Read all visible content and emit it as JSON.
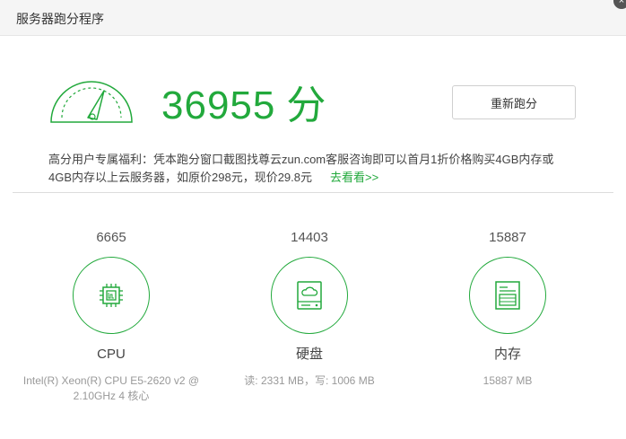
{
  "window": {
    "title": "服务器跑分程序",
    "close_label": "×"
  },
  "score": {
    "value": "36955",
    "unit": "分",
    "progress_fraction": 0.8
  },
  "rerun_button": {
    "label": "重新跑分"
  },
  "promo": {
    "line1": "高分用户专属福利：凭本跑分窗口截图找尊云zun.com客服咨询即可以首月1折价格购买4GB内存或",
    "line2": "4GB内存以上云服务器，如原价298元，现价29.8元",
    "link": "去看看>>"
  },
  "metrics": [
    {
      "score": "6665",
      "name": "CPU",
      "icon": "cpu-icon",
      "detail": "Intel(R) Xeon(R) CPU E5-2620 v2 @ 2.10GHz 4 核心"
    },
    {
      "score": "14403",
      "name": "硬盘",
      "icon": "hard-disk-cloud-icon",
      "detail": "读: 2331 MB，写: 1006 MB"
    },
    {
      "score": "15887",
      "name": "内存",
      "icon": "memory-icon",
      "detail": "15887 MB"
    }
  ],
  "colors": {
    "accent": "#22a93c",
    "titlebar_bg": "#f5f5f5"
  }
}
